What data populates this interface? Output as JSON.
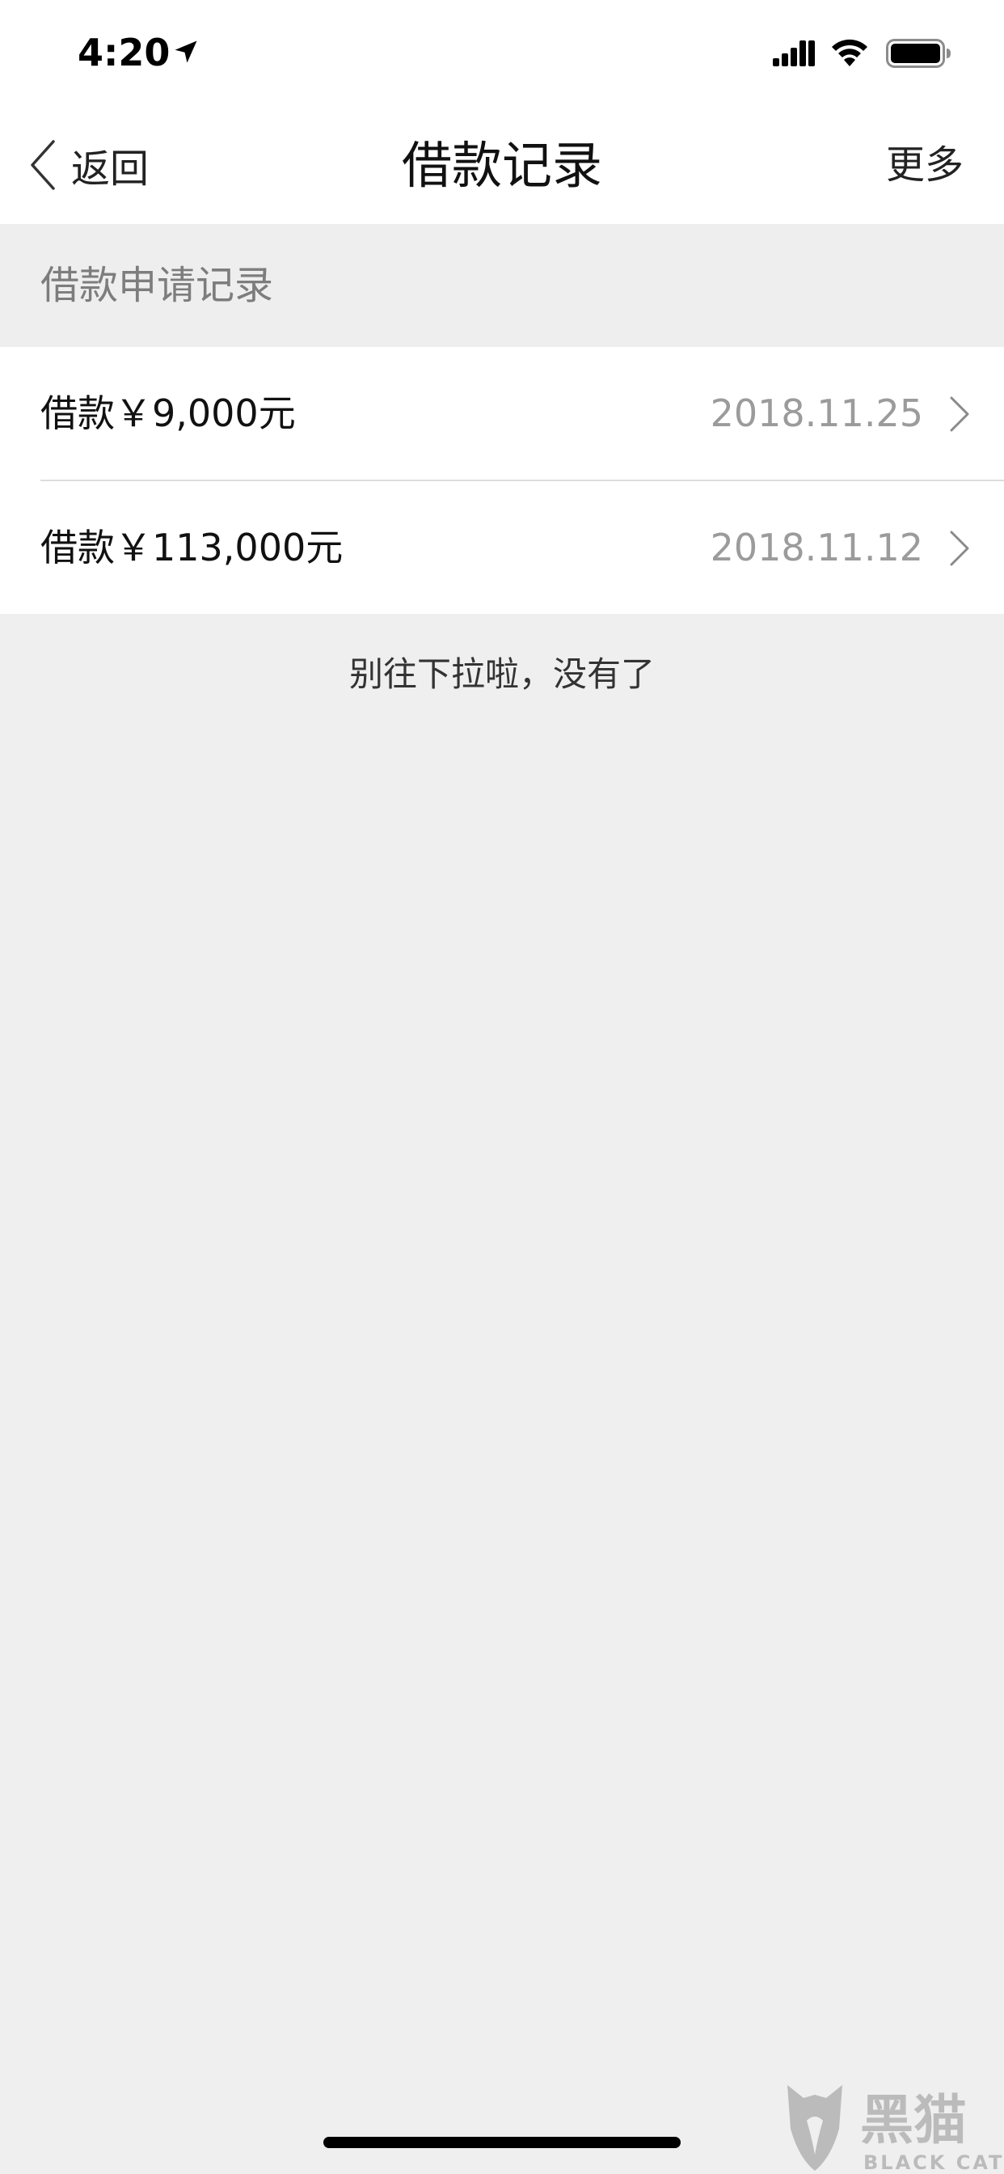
{
  "status_bar": {
    "time": "4:20",
    "icons": [
      "location-arrow-icon",
      "signal-icon",
      "wifi-icon",
      "battery-icon"
    ]
  },
  "nav": {
    "back_label": "返回",
    "title": "借款记录",
    "more_label": "更多"
  },
  "section": {
    "title": "借款申请记录"
  },
  "records": [
    {
      "label": "借款￥9,000元",
      "date": "2018.11.25"
    },
    {
      "label": "借款￥113,000元",
      "date": "2018.11.12"
    }
  ],
  "end_hint": "别往下拉啦，没有了",
  "watermark": {
    "brand_cn": "黑猫",
    "brand_en": "BLACK CAT"
  },
  "colors": {
    "background": "#efefef",
    "surface": "#ffffff",
    "secondary_text": "#9b9b9b"
  }
}
